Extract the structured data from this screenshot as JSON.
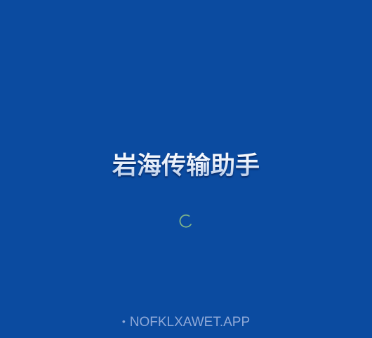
{
  "splash": {
    "title": "岩海传输助手",
    "domain_text": "NOFKLXAWET.APP",
    "bullet": "•"
  },
  "colors": {
    "background": "#0b4ba0",
    "spinner": "#7fb58a",
    "footer_text": "#8fa9d8"
  },
  "icons": {
    "spinner": "loading-spinner-icon"
  }
}
